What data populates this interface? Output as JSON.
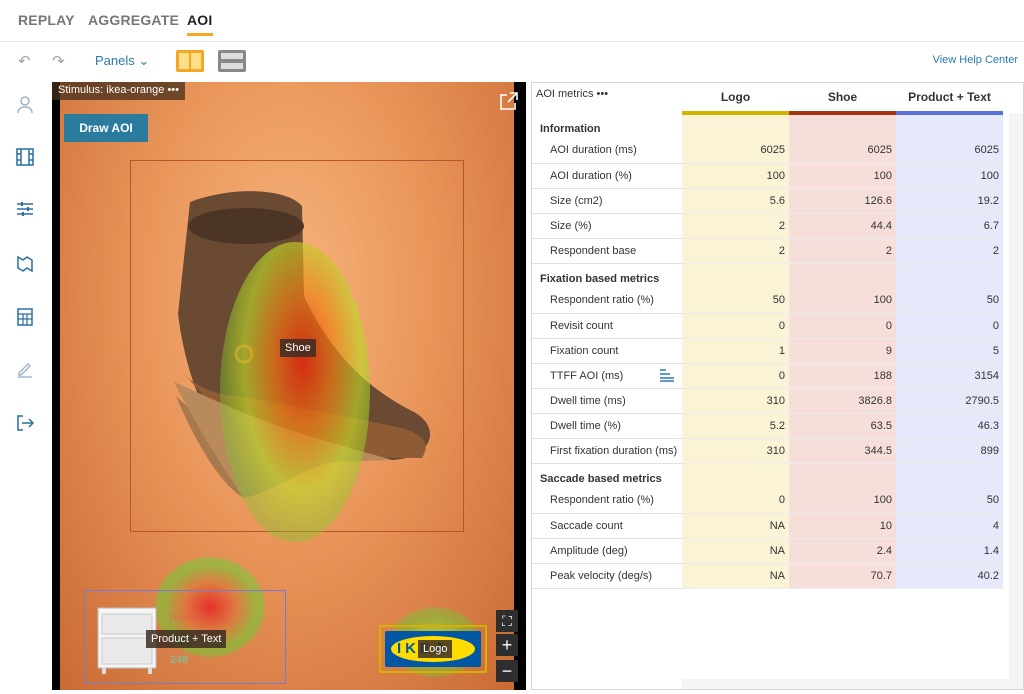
{
  "tabs": [
    {
      "label": "REPLAY"
    },
    {
      "label": "AGGREGATE"
    },
    {
      "label": "AOI"
    }
  ],
  "toolbar": {
    "panels_label": "Panels",
    "help_label": "View Help Center"
  },
  "sidebar": {
    "icons": [
      "user-icon",
      "film-icon",
      "sliders-icon",
      "map-icon",
      "calculator-icon",
      "edit-icon",
      "exit-icon"
    ]
  },
  "stimulus": {
    "header": "Stimulus: ikea-orange",
    "draw_aoi_label": "Draw AOI",
    "aoi_labels": {
      "shoe": "Shoe",
      "product_text": "Product + Text",
      "logo": "Logo"
    },
    "overlay_text": {
      "price": "248",
      "product_name": "Hemnes"
    },
    "logo_text": "IKEA"
  },
  "metrics": {
    "title": "AOI metrics",
    "columns": [
      "Logo",
      "Shoe",
      "Product + Text"
    ],
    "column_colors": [
      "#d4b200",
      "#a63412",
      "#5b73d9"
    ],
    "sections": [
      {
        "name": "Information",
        "rows": [
          {
            "label": "AOI duration (ms)",
            "values": [
              "6025",
              "6025",
              "6025"
            ]
          },
          {
            "label": "AOI duration (%)",
            "values": [
              "100",
              "100",
              "100"
            ]
          },
          {
            "label": "Size (cm2)",
            "values": [
              "5.6",
              "126.6",
              "19.2"
            ]
          },
          {
            "label": "Size (%)",
            "values": [
              "2",
              "44.4",
              "6.7"
            ]
          },
          {
            "label": "Respondent base",
            "values": [
              "2",
              "2",
              "2"
            ]
          }
        ]
      },
      {
        "name": "Fixation based metrics",
        "rows": [
          {
            "label": "Respondent ratio (%)",
            "values": [
              "50",
              "100",
              "50"
            ]
          },
          {
            "label": "Revisit count",
            "values": [
              "0",
              "0",
              "0"
            ]
          },
          {
            "label": "Fixation count",
            "values": [
              "1",
              "9",
              "5"
            ]
          },
          {
            "label": "TTFF AOI (ms)",
            "values": [
              "0",
              "188",
              "3154"
            ]
          },
          {
            "label": "Dwell time (ms)",
            "values": [
              "310",
              "3826.8",
              "2790.5"
            ]
          },
          {
            "label": "Dwell time (%)",
            "values": [
              "5.2",
              "63.5",
              "46.3"
            ]
          },
          {
            "label": "First fixation duration (ms)",
            "values": [
              "310",
              "344.5",
              "899"
            ]
          }
        ]
      },
      {
        "name": "Saccade based metrics",
        "rows": [
          {
            "label": "Respondent ratio (%)",
            "values": [
              "0",
              "100",
              "50"
            ]
          },
          {
            "label": "Saccade count",
            "values": [
              "NA",
              "10",
              "4"
            ]
          },
          {
            "label": "Amplitude (deg)",
            "values": [
              "NA",
              "2.4",
              "1.4"
            ]
          },
          {
            "label": "Peak velocity (deg/s)",
            "values": [
              "NA",
              "70.7",
              "40.2"
            ]
          }
        ]
      }
    ]
  }
}
